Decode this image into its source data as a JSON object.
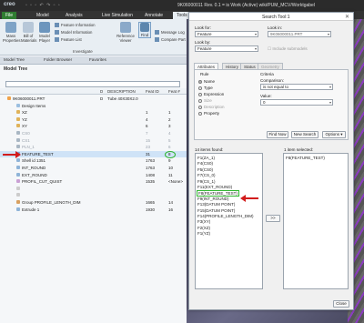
{
  "titlebar": {
    "logo": "creo",
    "window_title": "9K06000011 Rev. 0.1 = is Work (Active) wiki/PUM_MCV/Worktgabel"
  },
  "ribbon_tabs": [
    "File",
    "Model",
    "Analysis",
    "Live Simulation",
    "Annotate",
    "Tools"
  ],
  "ribbon": {
    "buttons": [
      {
        "label": "Mass Properties"
      },
      {
        "label": "Bill of Materials"
      },
      {
        "label": "Model Player"
      },
      {
        "label": "Reference Viewer"
      },
      {
        "label": "Find"
      }
    ],
    "investigate_items": [
      "Feature Information",
      "Model Information",
      "Feature List"
    ],
    "right_items": [
      "Message Log",
      "Compare Part"
    ],
    "group_label": "Investigate"
  },
  "model_tree": {
    "tabs": [
      "Model Tree",
      "Folder Browser",
      "Favorites"
    ],
    "title": "Model Tree",
    "columns": {
      "d": "D",
      "description": "DESCRIPTION",
      "feat_id": "Feat ID",
      "feat_num": "Feat #"
    },
    "rows": [
      {
        "name": "9K06000011.PRT",
        "d": "D",
        "desc": "Tube 40X30X2.0",
        "id": "",
        "num": "",
        "indent": 0,
        "dim": false
      },
      {
        "name": "Design Items",
        "d": "",
        "desc": "",
        "id": "",
        "num": "",
        "indent": 1,
        "dim": false
      },
      {
        "name": "XZ",
        "d": "",
        "desc": "",
        "id": "1",
        "num": "1",
        "indent": 1,
        "dim": false
      },
      {
        "name": "YZ",
        "d": "",
        "desc": "",
        "id": "4",
        "num": "2",
        "indent": 1,
        "dim": false
      },
      {
        "name": "XY",
        "d": "",
        "desc": "",
        "id": "6",
        "num": "3",
        "indent": 1,
        "dim": false
      },
      {
        "name": "CS0",
        "d": "",
        "desc": "",
        "id": "7",
        "num": "4",
        "indent": 1,
        "dim": true
      },
      {
        "name": "CS1",
        "d": "",
        "desc": "",
        "id": "15",
        "num": "5",
        "indent": 1,
        "dim": true
      },
      {
        "name": "PLN_1",
        "d": "",
        "desc": "",
        "id": "23",
        "num": "6",
        "indent": 1,
        "dim": true
      },
      {
        "name": "FEATURE_TEST",
        "d": "",
        "desc": "",
        "id": "31",
        "num": "8",
        "indent": 1,
        "dim": false
      },
      {
        "name": "Shell id 1351",
        "d": "",
        "desc": "",
        "id": "1763",
        "num": "9",
        "indent": 1,
        "dim": false
      },
      {
        "name": "INT_ROUND",
        "d": "",
        "desc": "",
        "id": "1763",
        "num": "10",
        "indent": 1,
        "dim": false
      },
      {
        "name": "EXT_ROUND",
        "d": "",
        "desc": "",
        "id": "1408",
        "num": "11",
        "indent": 1,
        "dim": false
      },
      {
        "name": "PROFIL_CUT_QUIST",
        "d": "",
        "desc": "",
        "id": "1535",
        "num": "<None>",
        "indent": 1,
        "dim": false
      },
      {
        "name": "",
        "d": "",
        "desc": "",
        "id": "",
        "num": "",
        "indent": 1,
        "dim": false
      },
      {
        "name": "",
        "d": "",
        "desc": "",
        "id": "",
        "num": "",
        "indent": 1,
        "dim": false
      },
      {
        "name": "Group PROFILE_LENGTH_DIM",
        "d": "",
        "desc": "",
        "id": "1665",
        "num": "14",
        "indent": 1,
        "dim": false
      },
      {
        "name": "Extrude 1",
        "d": "",
        "desc": "",
        "id": "1930",
        "num": "16",
        "indent": 1,
        "dim": false
      }
    ]
  },
  "dialog": {
    "title": "Search Tool:1",
    "look_for_label": "Look for:",
    "look_for_value": "Feature",
    "look_in_label": "Look in:",
    "look_in_value": "9K06000011.PRT",
    "look_by_label": "Look by:",
    "look_by_value": "Feature",
    "include_submodels": "Include submodels",
    "tabs": [
      "Attributes",
      "History",
      "Status",
      "Geometry"
    ],
    "rule_header": "Rule",
    "criteria_header": "Criteria",
    "rules": [
      "Name",
      "Type",
      "Expression",
      "Size",
      "Description",
      "Property"
    ],
    "comparison_label": "Comparison:",
    "comparison_value": "is not equal to",
    "value_label": "Value:",
    "value_value": "0",
    "find_now": "Find Now",
    "new_search": "New Search",
    "options": "Options",
    "found_label": "14 items found:",
    "selected_label": "1 item selected:",
    "found_items": [
      "F1(ZA_1)",
      "F4(CS0)",
      "F5(CS0)",
      "F7(CS_0)",
      "F9(CS_1)",
      "F11(EXT_ROUND)",
      "F8(FEATURE_TEST)",
      "F9(INT_ROUND)",
      "F13(DATUM POINT)",
      "F15(DATUM POINT)",
      "F14(PROFILE_LENGTH_DIM)",
      "F3(XY)",
      "F2(XZ)",
      "F1(YZ)"
    ],
    "selected_items": [
      "F8(FEATURE_TEST)"
    ],
    "move_button": ">>",
    "close": "Close"
  },
  "colors": {
    "green_highlight": "#2fb52f",
    "red_arrow": "#d21c1c",
    "file_tab": "#2f7d31"
  }
}
